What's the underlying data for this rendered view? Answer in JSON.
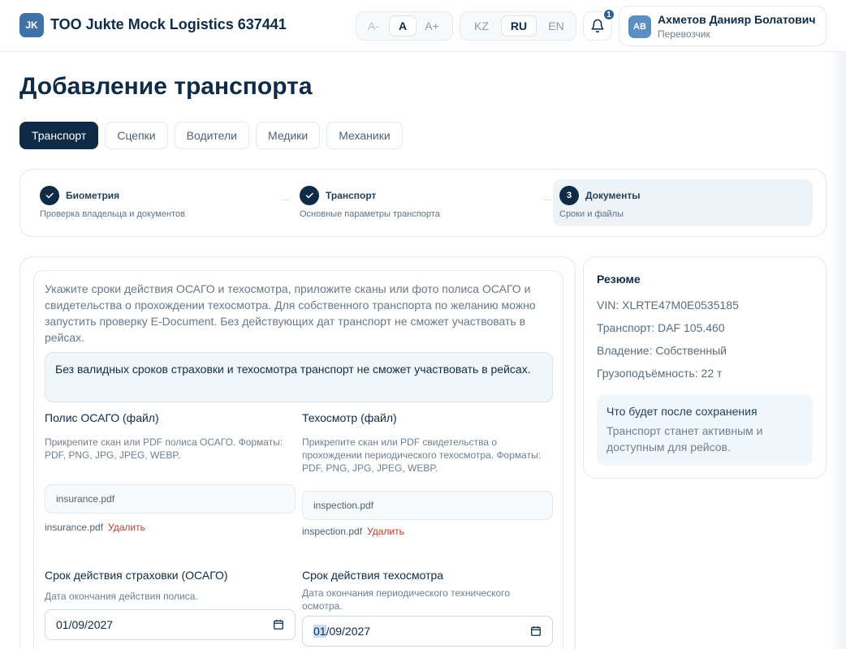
{
  "header": {
    "logo_text": "JK",
    "company": "TOO Jukte Mock Logistics 637441",
    "font_size": [
      "A-",
      "A",
      "A+"
    ],
    "languages": [
      "KZ",
      "RU",
      "EN"
    ],
    "notifications_count": "1",
    "user": {
      "initials": "AB",
      "name": "Ахметов Данияр Болатович",
      "role": "Перевозчик"
    }
  },
  "page": {
    "title": "Добавление транспорта",
    "tabs": [
      "Транспорт",
      "Сцепки",
      "Водители",
      "Медики",
      "Механики"
    ]
  },
  "stepper": [
    {
      "title": "Биометрия",
      "subtitle": "Проверка владельца и документов",
      "status": "done"
    },
    {
      "title": "Транспорт",
      "subtitle": "Основные параметры транспорта",
      "status": "done"
    },
    {
      "number": "3",
      "title": "Документы",
      "subtitle": "Сроки и файлы",
      "status": "current"
    }
  ],
  "form": {
    "intro": "Укажите сроки действия ОСАГО и техосмотра, приложите сканы или фото полиса ОСАГО и свидетельства о прохождении техосмотра. Для собственного транспорта по желанию можно запустить проверку E-Document. Без действующих дат транспорт не сможет участвовать в рейсах.",
    "notice": "Без валидных сроков страховки и техосмотра транспорт не сможет участвовать в рейсах.",
    "insurance_file": {
      "label": "Полис ОСАГО (файл)",
      "hint": "Прикрепите скан или PDF полиса ОСАГО. Форматы: PDF, PNG, JPG, JPEG, WEBP.",
      "value": "insurance.pdf",
      "attached": "insurance.pdf",
      "delete": "Удалить"
    },
    "inspection_file": {
      "label": "Техосмотр (файл)",
      "hint": "Прикрепите скан или PDF свидетельства о прохождении периодического техосмотра. Форматы: PDF, PNG, JPG, JPEG, WEBP.",
      "value": "inspection.pdf",
      "attached": "inspection.pdf",
      "delete": "Удалить"
    },
    "insurance_date": {
      "label": "Срок действия страховки (ОСАГО)",
      "hint": "Дата окончания действия полиса.",
      "value": "01/09/2027"
    },
    "inspection_date": {
      "label": "Срок действия техосмотра",
      "hint": "Дата окончания периодического технического осмотра.",
      "value_selected": "01",
      "value_rest": "/09/2027"
    }
  },
  "summary": {
    "title": "Резюме",
    "rows": [
      "VIN: XLRTE47M0E0535185",
      "Транспорт: DAF 105.460",
      "Владение: Собственный",
      "Грузоподъёмность: 22 т"
    ],
    "after_title": "Что будет после сохранения",
    "after_text": "Транспорт станет активным и доступным для рейсов."
  }
}
